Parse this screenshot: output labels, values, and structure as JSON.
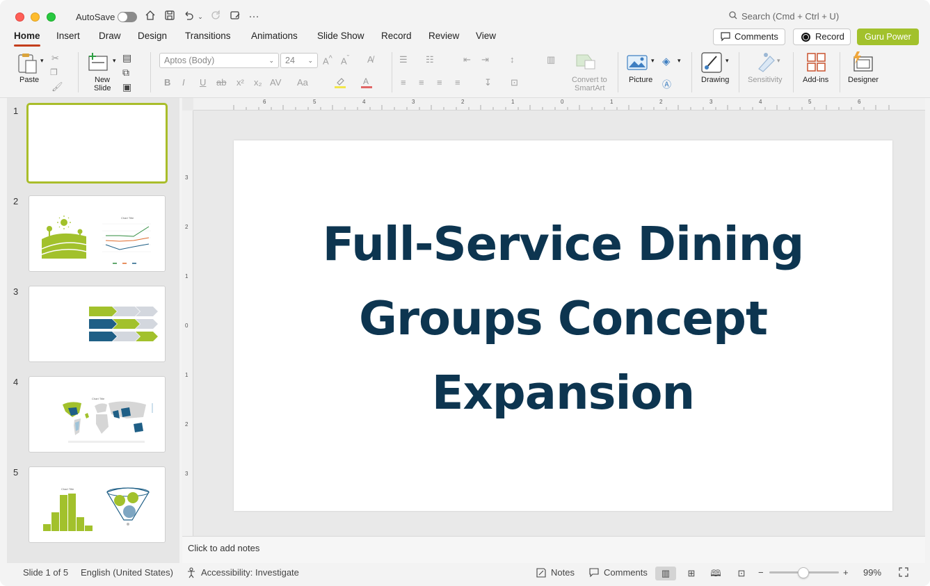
{
  "titlebar": {
    "autosave_label": "AutoSave",
    "search_placeholder": "Search (Cmd + Ctrl + U)"
  },
  "tabs": [
    "Home",
    "Insert",
    "Draw",
    "Design",
    "Transitions",
    "Animations",
    "Slide Show",
    "Record",
    "Review",
    "View"
  ],
  "header_buttons": {
    "comments": "Comments",
    "record": "Record",
    "guru": "Guru Power"
  },
  "ribbon": {
    "paste": "Paste",
    "new_slide_1": "New",
    "new_slide_2": "Slide",
    "font_name": "Aptos (Body)",
    "font_size": "24",
    "convert_1": "Convert to",
    "convert_2": "SmartArt",
    "picture": "Picture",
    "drawing": "Drawing",
    "sensitivity": "Sensitivity",
    "addins": "Add-ins",
    "designer": "Designer"
  },
  "slides": [
    {
      "number": "1"
    },
    {
      "number": "2",
      "mini_title": "Chart Title"
    },
    {
      "number": "3"
    },
    {
      "number": "4",
      "mini_title": "Chart Title"
    },
    {
      "number": "5",
      "mini_title": "Chart Title"
    }
  ],
  "ruler": {
    "h_ticks": [
      "6",
      "5",
      "4",
      "3",
      "2",
      "1",
      "0",
      "1",
      "2",
      "3",
      "4",
      "5",
      "6"
    ],
    "v_ticks": [
      "3",
      "2",
      "1",
      "0",
      "1",
      "2",
      "3"
    ]
  },
  "slide": {
    "title_line1": "Full-Service Dining",
    "title_line2": "Groups Concept",
    "title_line3": "Expansion",
    "title_color": "#0d3550"
  },
  "notes_placeholder": "Click to add notes",
  "status": {
    "slide_of": "Slide 1 of 5",
    "language": "English (United States)",
    "accessibility": "Accessibility: Investigate",
    "notes": "Notes",
    "comments": "Comments",
    "zoom": "99%"
  },
  "colors": {
    "accent_green": "#a2c12c",
    "brand_red": "#c43e1c",
    "navy": "#0d3550",
    "teal": "#1f5f86"
  }
}
